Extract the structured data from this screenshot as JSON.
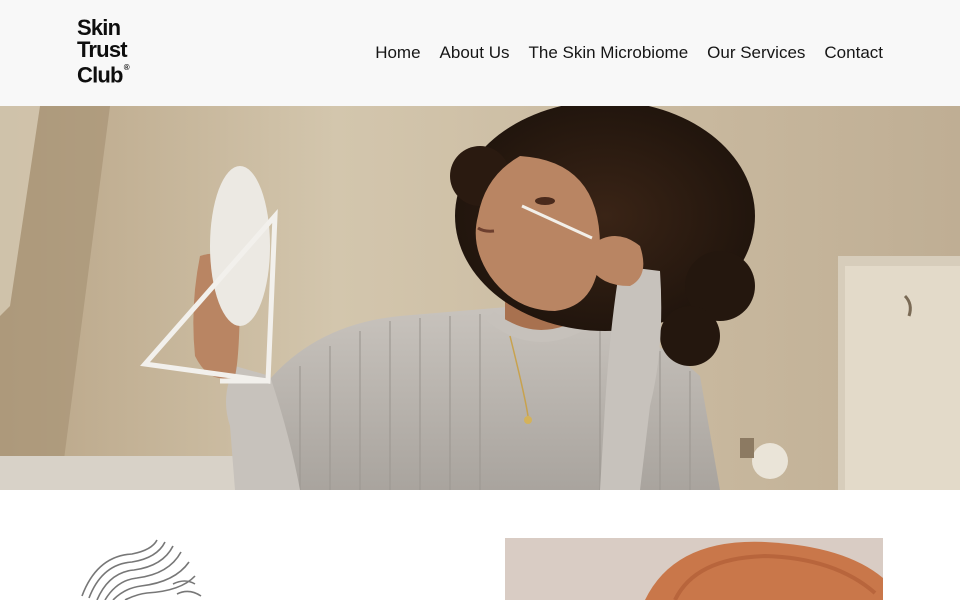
{
  "brand": {
    "logo_lines": [
      "Skin",
      "Trust",
      "Club"
    ],
    "registered_mark": "®"
  },
  "nav": {
    "items": [
      {
        "label": "Home"
      },
      {
        "label": "About Us"
      },
      {
        "label": "The Skin Microbiome"
      },
      {
        "label": "Our Services"
      },
      {
        "label": "Contact"
      }
    ]
  },
  "colors": {
    "header_bg": "#f8f8f8",
    "hero_wall": "#cdbfa7",
    "sweater": "#b9b4ae",
    "hair": "#2a1a10",
    "skin": "#b98563"
  },
  "icons": {
    "topography": "topographic-lines-icon"
  }
}
